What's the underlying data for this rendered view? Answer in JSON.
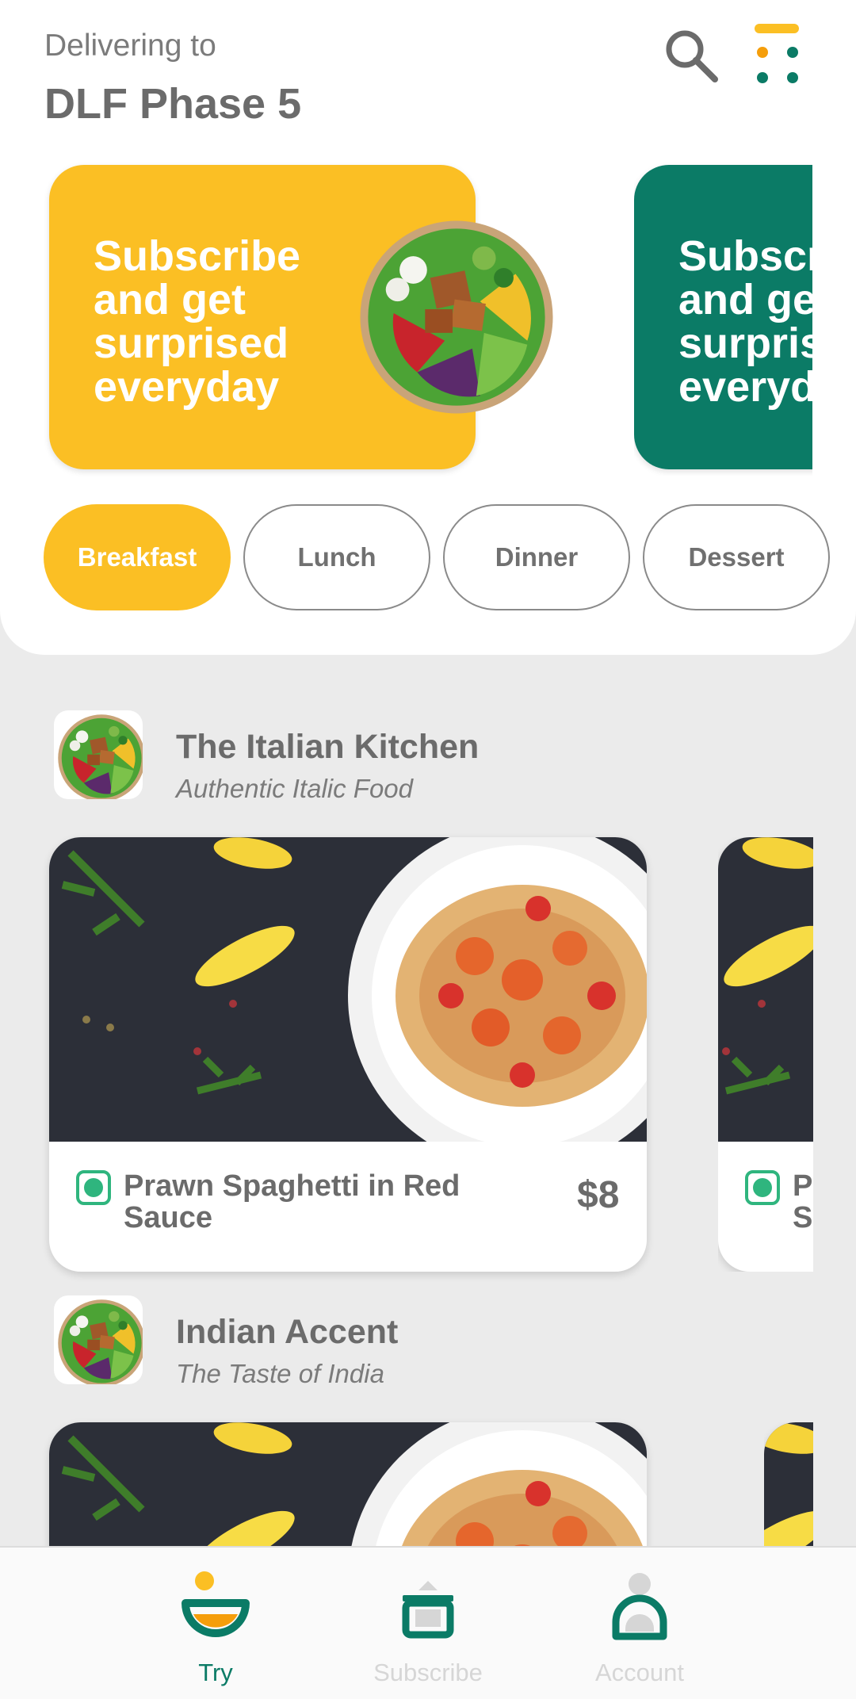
{
  "header": {
    "delivering_label": "Delivering to",
    "location": "DLF Phase 5"
  },
  "banners": [
    {
      "text": "Subscribe and get surprised everyday",
      "color": "#fbbf24"
    },
    {
      "text": "Subscribe and get surprised everyday",
      "color": "#0b7b66"
    }
  ],
  "categories": [
    {
      "label": "Breakfast",
      "active": true
    },
    {
      "label": "Lunch",
      "active": false
    },
    {
      "label": "Dinner",
      "active": false
    },
    {
      "label": "Dessert",
      "active": false
    }
  ],
  "restaurants": [
    {
      "name": "The Italian Kitchen",
      "tagline": "Authentic Italic Food",
      "dish": {
        "name": "Prawn Spaghetti in Red Sauce",
        "price": "$8",
        "veg": true
      },
      "next_dish_partial": "P S"
    },
    {
      "name": "Indian Accent",
      "tagline": "The Taste of India"
    }
  ],
  "bottom_nav": [
    {
      "label": "Try",
      "active": true,
      "icon": "bowl-icon"
    },
    {
      "label": "Subscribe",
      "active": false,
      "icon": "pot-icon"
    },
    {
      "label": "Account",
      "active": false,
      "icon": "user-icon"
    }
  ],
  "colors": {
    "accent_yellow": "#fbbf24",
    "accent_green": "#0b7b66",
    "veg_green": "#2fb57e",
    "nav_active": "#0b7b66",
    "nav_inactive": "#d6d6d6"
  }
}
